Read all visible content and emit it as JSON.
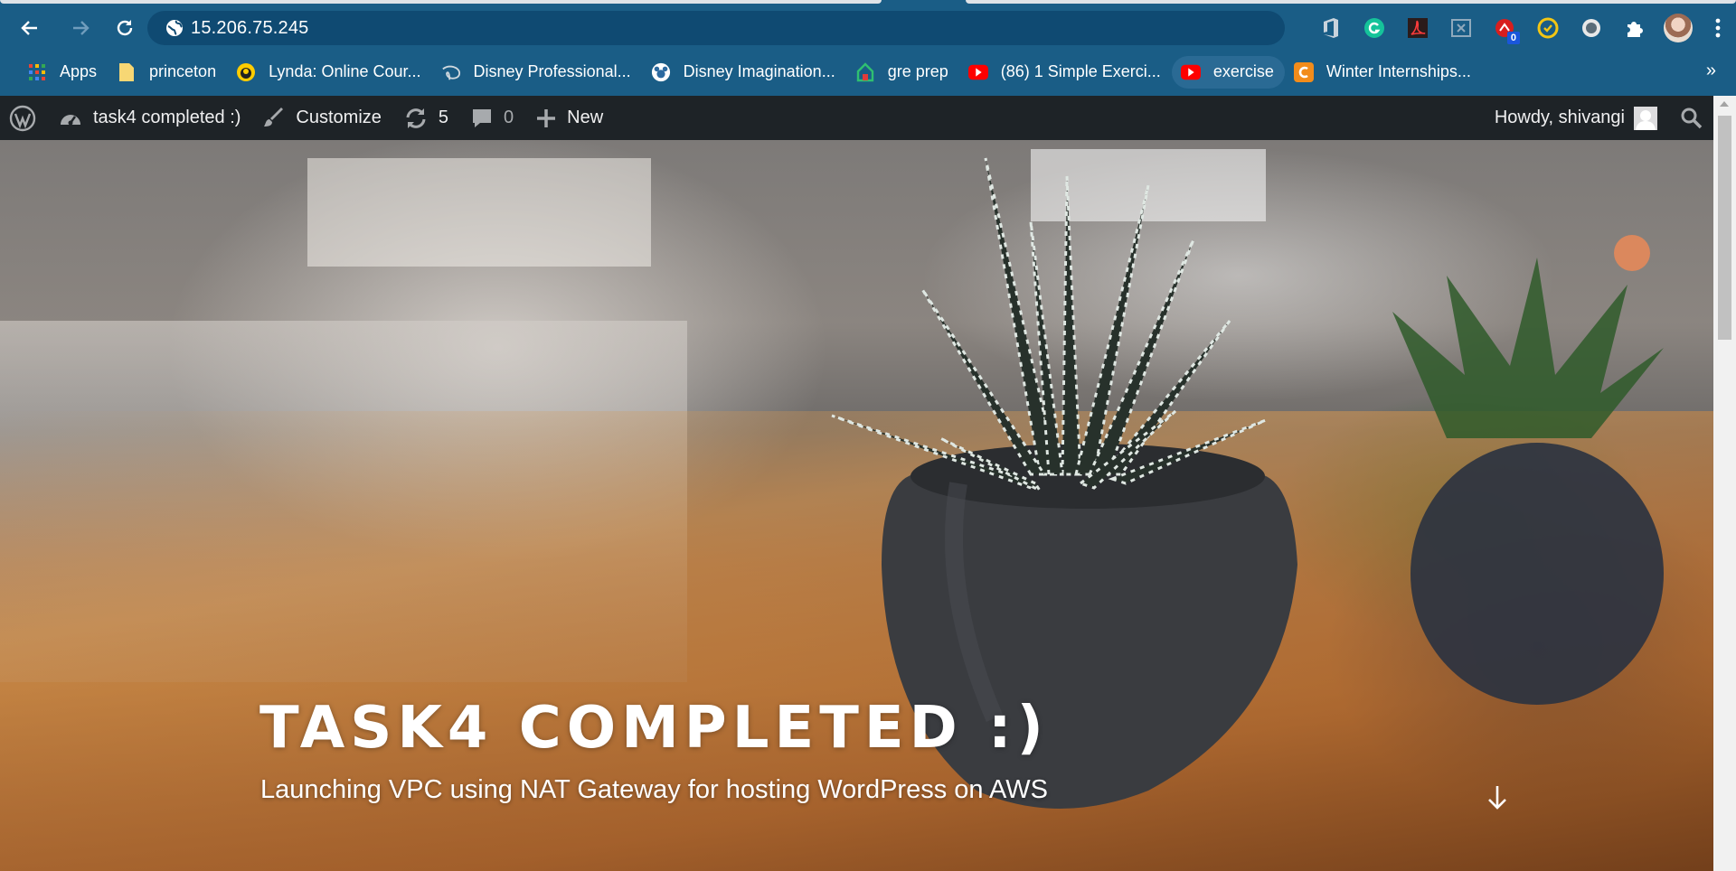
{
  "browser": {
    "url": "15.206.75.245",
    "extension_badge_count": "0",
    "icons": [
      "back-icon",
      "forward-icon",
      "reload-icon",
      "site-info-icon",
      "office-icon",
      "grammarly-icon",
      "acrobat-icon",
      "extension-icon",
      "counter-extension-icon",
      "norton-icon",
      "record-icon",
      "puzzle-icon",
      "profile-avatar",
      "menu-icon"
    ]
  },
  "bookmarks": [
    {
      "label": "Apps",
      "icon": "apps-grid-icon"
    },
    {
      "label": "princeton",
      "icon": "folder-icon"
    },
    {
      "label": "Lynda: Online Cour...",
      "icon": "lynda-icon"
    },
    {
      "label": "Disney Professional...",
      "icon": "disney-icon"
    },
    {
      "label": "Disney Imagination...",
      "icon": "mickey-icon"
    },
    {
      "label": "gre prep",
      "icon": "home-green-icon"
    },
    {
      "label": "(86) 1 Simple Exerci...",
      "icon": "youtube-icon"
    },
    {
      "label": "exercise",
      "icon": "youtube-icon"
    },
    {
      "label": "Winter Internships...",
      "icon": "c-orange-icon"
    }
  ],
  "bookmarks_more": "»",
  "adminbar": {
    "site_name": "task4 completed :)",
    "customize": "Customize",
    "updates_count": "5",
    "comments_count": "0",
    "new_label": "New",
    "howdy": "Howdy, shivangi"
  },
  "hero": {
    "title": "TASK4 COMPLETED :)",
    "tagline": "Launching VPC using NAT Gateway for hosting WordPress on AWS"
  },
  "colors": {
    "chrome_blue": "#1a5d86",
    "wp_adminbar": "#1e2327"
  }
}
